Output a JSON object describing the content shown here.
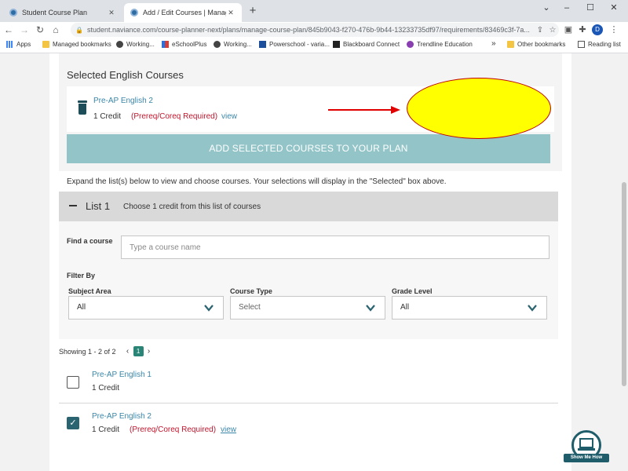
{
  "browser": {
    "tabs": [
      {
        "title": "Student Course Plan",
        "close": "✕"
      },
      {
        "title": "Add / Edit Courses | Manage Cou",
        "close": "✕"
      }
    ],
    "new_tab": "+",
    "window_controls": {
      "minimize": "–",
      "maximize": "☐",
      "close": "✕",
      "chevron": "⌄"
    },
    "url": "student.naviance.com/course-planner-next/plans/manage-course-plan/845b9043-f270-476b-9b44-13233735df97/requirements/83469c3f-7a...",
    "profile_initial": "D",
    "bookmarks": [
      {
        "label": "Apps",
        "color": "#4285f4"
      },
      {
        "label": "Managed bookmarks",
        "color": "#f4c542"
      },
      {
        "label": "Working...",
        "color": "#444444"
      },
      {
        "label": "eSchoolPlus",
        "color": "#2f6fd6"
      },
      {
        "label": "Working...",
        "color": "#444444"
      },
      {
        "label": "Powerschool - varia...",
        "color": "#1b4e9b"
      },
      {
        "label": "Blackboard Connect",
        "color": "#222222"
      },
      {
        "label": "Trendline Education",
        "color": "#8a3fb0"
      }
    ],
    "bookmarks_more": "»",
    "other_bookmarks": "Other bookmarks",
    "reading_list": "Reading list"
  },
  "selected": {
    "heading": "Selected English Courses",
    "course": {
      "name": "Pre-AP English 2",
      "credit": "1 Credit",
      "prereq": "(Prereq/Coreq Required)",
      "view": "view"
    },
    "add_button": "ADD SELECTED COURSES TO YOUR PLAN"
  },
  "instructions": "Expand the list(s) below to view and choose courses. Your selections will display in the \"Selected\" box above.",
  "list": {
    "title": "List 1",
    "description": "Choose 1 credit from this list of courses",
    "find_label": "Find a course",
    "find_placeholder": "Type a course name",
    "filter_by": "Filter By",
    "filters": [
      {
        "label": "Subject Area",
        "value": "All"
      },
      {
        "label": "Course Type",
        "value": "Select"
      },
      {
        "label": "Grade Level",
        "value": "All"
      }
    ]
  },
  "pagination": {
    "showing": "Showing 1 - 2 of 2",
    "prev": "‹",
    "page": "1",
    "next": "›"
  },
  "courses": [
    {
      "name": "Pre-AP English 1",
      "credit": "1 Credit",
      "prereq": "",
      "view": "",
      "checked": false
    },
    {
      "name": "Pre-AP English 2",
      "credit": "1 Credit",
      "prereq": "(Prereq/Coreq Required)",
      "view": "view",
      "checked": true
    }
  ],
  "help_button": "Show Me How",
  "colors": {
    "add_button": "#93c4c8",
    "prereq": "#c0162d",
    "link": "#3a86a8",
    "accent": "#2a6470",
    "annotation_arrow": "#e00000",
    "annotation_oval": "#ffff00"
  }
}
